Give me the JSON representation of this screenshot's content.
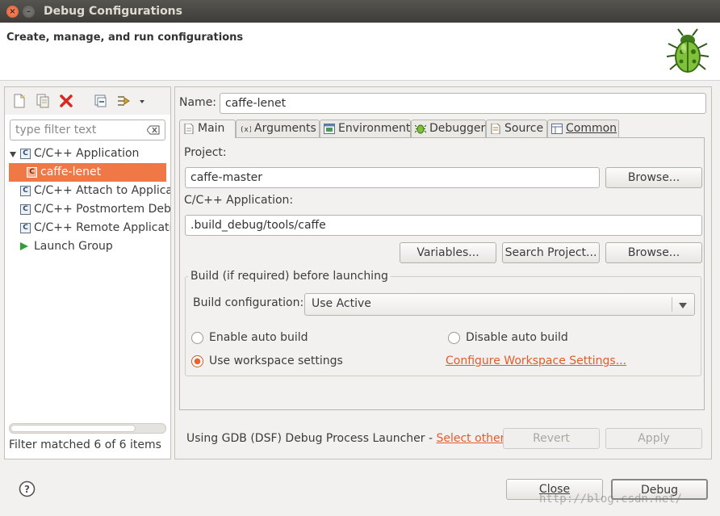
{
  "window": {
    "title": "Debug Configurations",
    "close_glyph": "×",
    "min_glyph": "–"
  },
  "banner": {
    "text": "Create, manage, and run configurations",
    "icon": "bug-icon"
  },
  "left": {
    "toolbar": [
      "new-config-icon",
      "duplicate-icon",
      "delete-icon",
      "collapse-all-icon",
      "filter-icon",
      "dropdown-arrow-icon"
    ],
    "filter_placeholder": "type filter text",
    "filter_value": "",
    "tree": [
      {
        "label": "C/C++ Application",
        "expanded": true
      },
      {
        "label": "caffe-lenet",
        "selected": true
      },
      {
        "label": "C/C++ Attach to Applicat"
      },
      {
        "label": "C/C++ Postmortem Debu"
      },
      {
        "label": "C/C++ Remote Applicatic"
      },
      {
        "label": "Launch Group"
      }
    ],
    "c_glyph": "C",
    "status": "Filter matched 6 of 6 items"
  },
  "right": {
    "name_label": "Name:",
    "name_value": "caffe-lenet",
    "tabs": [
      "Main",
      "Arguments",
      "Environment",
      "Debugger",
      "Source",
      "Common"
    ],
    "active_tab": "Main",
    "project_label": "Project:",
    "project_value": "caffe-master",
    "browse1": "Browse...",
    "app_label": "C/C++ Application:",
    "app_value": ".build_debug/tools/caffe",
    "variables": "Variables...",
    "search_project": "Search Project...",
    "browse2": "Browse...",
    "build": {
      "title": "Build (if required) before launching",
      "config_label": "Build configuration:",
      "config_value": "Use Active",
      "enable_auto": "Enable auto build",
      "disable_auto": "Disable auto build",
      "use_workspace": "Use workspace settings",
      "configure_link": "Configure Workspace Settings...",
      "selected": "use_workspace"
    },
    "launcher_text": "Using GDB (DSF) Debug Process Launcher - ",
    "select_other": "Select other...",
    "revert": "Revert",
    "apply": "Apply"
  },
  "footer": {
    "help_glyph": "?",
    "close": "Close",
    "debug": "Debug",
    "watermark": "http://blog.csdn.net/"
  },
  "colors": {
    "accent": "#f07746",
    "link": "#e25c28",
    "titlebar": "#3e3d39"
  }
}
